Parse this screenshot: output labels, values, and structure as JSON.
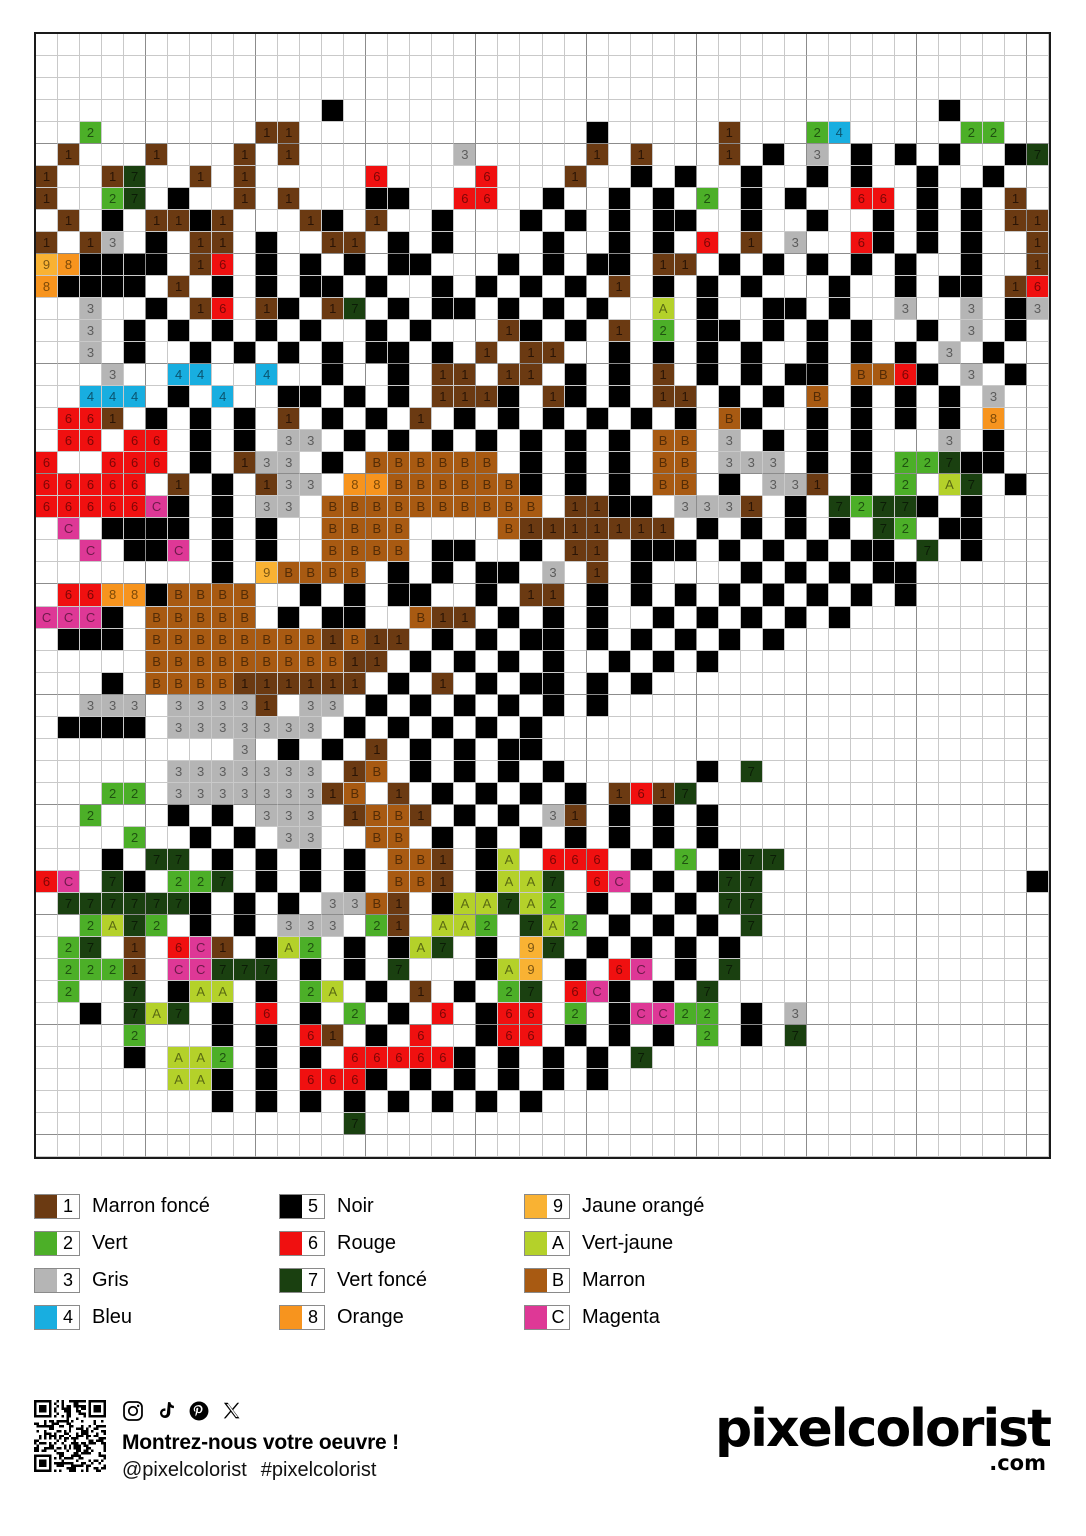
{
  "grid": {
    "columns": 46,
    "rows": 51,
    "legend_note": "Each string is one row; '.' = empty cell, other chars = color code",
    "cells": [
      "..............................................",
      "..............................................",
      "..............................................",
      ".............5...........................5....",
      "..2.......11.............5.....1...24.....22..",
      ".1...1...1.1.......3.....1.1...1.5.3.5.5.5..57",
      "1..17..1.1.....6....6...1..5.5..5..5.5..5..5..",
      "1..27.5..1.1...55..66..5..5.5.2.5.5..66.5.5.1.",
      ".1.5.1151...15.1..5...5.5.5.55..5..5..5.5.5.11",
      "1.13.5.11.5..11.5.5....5..5.5.6.1.3..65.5.5..1",
      "985555.16.5.5.5.55...5.5.55.11.5.5.5.5.5..5..1",
      "85555.1.5.5.55.5..5.5.5.5.1.5.5.5...5..5.55.16",
      "..3..5.16.15.17.5.55.5.5.5..A.5..55.5..3..3.53",
      "..3.5.5.5.5.5..5.5...15.5.1.2.55.5.5.5..5.3.5.",
      "..3.5..5.5.5.5.55.5.1.11..5.5.5.5..5.5.5.3.5..",
      "...3..44..4..5..5.11.11.5.5.1.5.5.55.BB65.3.5.",
      "..444.5.4..55.5.5.1115.15.5.11.5.5.B.5.5.5.3..",
      ".661.5.5.5.1.5.5.1.5.5.5.5.5.5.B5..5.5.5.5.8..",
      ".66.66.5.5.33.5.5.5.5.5.5.5.BB.3.5.5.5...3.5..",
      "6..666.5.133.5.BBBBBB.5.5.5.BB.333.5.5.22755..",
      "66666.1.5.133.88BBBBBB5.5.5.BB.5.331.5.2.A7.5.",
      "66666C5.5.33.BBBBBBBBBB.1155.3331.5.72775.5...",
      ".C.5555.5.5..BBBB....B1111111.5.5.5.5.72.55...",
      "..C.55C.5.5..BBBB.55..5.11.555.5.5.5.55.7.5...",
      "........5.9BBBB.5.5.55.3.1.5....5.5.5.55......",
      ".66885BBBB..5.5.55..5.11.5.5.5.5.5.5.5.5......",
      "CCC5.BBBBB.5.55..B11.5.5.5..5.5.5.5.5.........",
      ".555.BBBBBBBB1B11.5.5.55.5.5.5.5.5............",
      ".....BBBBBBBBB11.5.5.5.5..5.5.5...............",
      "...5.BBBB111111.5.1.5.55.5.5..................",
      "..333.33331.33.5.5.5.5.5.5....................",
      ".5555.3333333.5.5.5.5.5.......................",
      ".........3.5.5.1.5.5.55.......................",
      "......3333333.1B.5.5.5.5......5.7.............",
      "...22.33333331B.1.5.5.5.5.1617................",
      "..2...5.5.333.1BB1.5.5.31.5.5.5...............",
      "....2..5.5.33..BB.5.5.5.5.5.5.5...............",
      "...5.77.5.5.5.5.BB1.5A.666.5.2.577............",
      "6C.75.227.5.5.5.BB1.5AA7.6C.5.577............5",
      ".7777775.5.5.33B1.5AA7A2.5.5.5.77.............",
      "..2A72.5.5.333.21.AA2.7A2.5.5.5.7.............",
      ".27 1.6C1.5A2.5.5A7.5.97.5.5.5.5..............",
      ".2221.CC777.5.5.7...5A9.5.6C.5.7..............",
      ".2..7.5AA.5.2A.5.1.5.27.6C5.5.7...............",
      "..5.7A7.5.6.5.2.5.6.566.2.5CC22.5.3...........",
      "....2...5.5.61.5.6..566.5.5.5.2.5.7...........",
      "....5.AA2.5.5.666665.5.5.5.7..................",
      "......AA5.5.6665.5.5.5.5.5....................",
      "........5.5.5.5.5.5.5.5.......................",
      "..............7...............................",
      ".............................................."
    ]
  },
  "legend": {
    "items": [
      {
        "code": "1",
        "color": "#6B3A12",
        "label": "Marron foncé"
      },
      {
        "code": "5",
        "color": "#000000",
        "label": "Noir"
      },
      {
        "code": "9",
        "color": "#F9B233",
        "label": "Jaune orangé"
      },
      {
        "code": "2",
        "color": "#4CAF28",
        "label": "Vert"
      },
      {
        "code": "6",
        "color": "#F01010",
        "label": "Rouge"
      },
      {
        "code": "A",
        "color": "#B4D12A",
        "label": "Vert-jaune"
      },
      {
        "code": "3",
        "color": "#B5B5B5",
        "label": "Gris"
      },
      {
        "code": "7",
        "color": "#1A4010",
        "label": "Vert foncé"
      },
      {
        "code": "B",
        "color": "#A85A12",
        "label": "Marron"
      },
      {
        "code": "4",
        "color": "#18AEE0",
        "label": "Bleu"
      },
      {
        "code": "8",
        "color": "#F7941E",
        "label": "Orange"
      },
      {
        "code": "C",
        "color": "#DE3896",
        "label": "Magenta"
      }
    ]
  },
  "footer": {
    "cta": "Montrez-nous votre oeuvre !",
    "handle": "@pixelcolorist",
    "hashtag": "#pixelcolorist",
    "social": [
      {
        "name": "instagram-icon"
      },
      {
        "name": "tiktok-icon"
      },
      {
        "name": "pinterest-icon"
      },
      {
        "name": "x-twitter-icon"
      }
    ],
    "brand": "pixelcolorist",
    "brand_tld": ".com",
    "qr": "qr-code"
  }
}
